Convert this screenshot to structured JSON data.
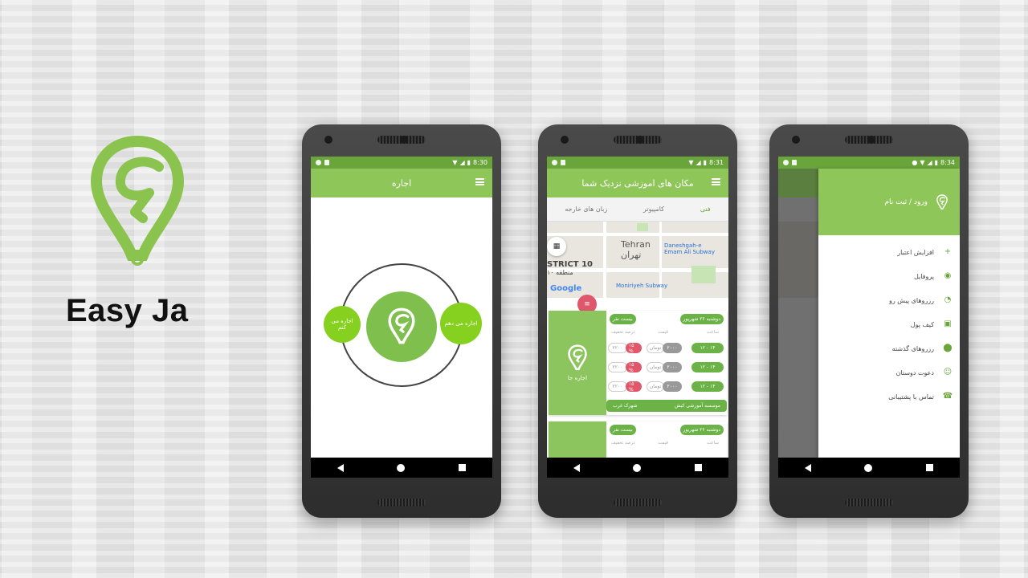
{
  "brand": {
    "name": "Easy Ja"
  },
  "colors": {
    "accent": "#8fc65a",
    "statusbar": "#6aa53c",
    "bright_green": "#86d11f",
    "pink": "#e0566a"
  },
  "phone1": {
    "time": "8:30",
    "title": "اجاره",
    "left_button": "اجاره می کنم",
    "right_button": "اجاره می دهم"
  },
  "phone2": {
    "time": "8:31",
    "title": "مکان های اموزشی نزدیک شما",
    "tabs": [
      "زبان های خارجه",
      "کامپیوتر",
      "فنی"
    ],
    "map": {
      "city_en": "Tehran",
      "city_fa": "تهران",
      "district": "STRICT 10",
      "district_fa": "منطقه ۱۰",
      "subway1": "Daneshgah-e Emam Ali Subway",
      "subway2": "Moniriyeh Subway",
      "google": "Google"
    },
    "card1": {
      "logo_text": "اجاره جا",
      "date": "دوشنبه ۲۶ شهریور",
      "capacity": "بیست نفر",
      "headers": [
        "ساعت",
        "قیمت",
        "درصد تخفیف"
      ],
      "rows": [
        {
          "time": "۱۲ - ۱۴",
          "price": "۲۰۰۰",
          "unit": "تومان",
          "discount": "۱۵ %",
          "old": "۲۲۰۰"
        },
        {
          "time": "۱۲ - ۱۴",
          "price": "۲۰۰۰",
          "unit": "تومان",
          "discount": "۱۵ %",
          "old": "۲۲۰۰"
        },
        {
          "time": "۱۲ - ۱۴",
          "price": "۲۰۰۰",
          "unit": "تومان",
          "discount": "۱۵ %",
          "old": "۲۲۰۰"
        }
      ],
      "footer_name": "موسسه آموزشی کیش",
      "footer_place": "شهرک غرب"
    },
    "card2": {
      "date": "دوشنبه ۲۶ شهریور",
      "capacity": "بیست نفر",
      "headers": [
        "ساعت",
        "قیمت",
        "درصد تخفیف"
      ]
    }
  },
  "phone3": {
    "time": "8:34",
    "drawer_title": "ورود / ثبت نام",
    "items": [
      {
        "label": "افزایش اعتبار",
        "icon": "plus-icon"
      },
      {
        "label": "پروفایل",
        "icon": "profile-icon"
      },
      {
        "label": "رزروهای پیش رو",
        "icon": "timer-icon"
      },
      {
        "label": "کیف پول",
        "icon": "wallet-icon"
      },
      {
        "label": "رزروهای گذشته",
        "icon": "location-icon"
      },
      {
        "label": "دعوت دوستان",
        "icon": "smile-icon"
      },
      {
        "label": "تماس با پشتیبانی",
        "icon": "phone-icon"
      }
    ]
  }
}
